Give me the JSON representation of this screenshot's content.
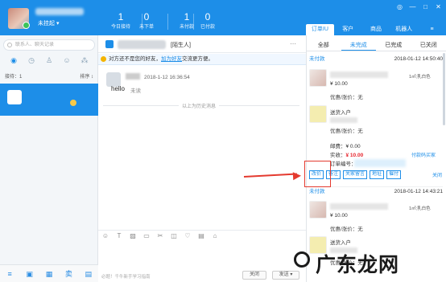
{
  "header": {
    "status": "未挂起 ▾",
    "stats": [
      {
        "num": "1",
        "label": "今日接待"
      },
      {
        "num": "0",
        "label": "未下单"
      },
      {
        "num": "1",
        "label": "未付款"
      },
      {
        "num": "0",
        "label": "已付款"
      }
    ],
    "right_tabs": [
      "订单IU",
      "客户",
      "商品",
      "机器人",
      "≡"
    ],
    "window_controls": [
      "◎",
      "—",
      "□",
      "✕"
    ]
  },
  "left": {
    "search_placeholder": "联系人、聊天记录",
    "sort_left": "接待：1",
    "sort_right": "排序 ↕",
    "nav_icons": [
      "chat-icon",
      "clock-icon",
      "person-icon",
      "group-icon",
      "share-icon"
    ],
    "bottom_icons": [
      "menu-icon",
      "inbox-icon",
      "grid-icon",
      "form-icon",
      "shop-icon"
    ]
  },
  "chat": {
    "tag": "[陌生人]",
    "notice_prefix": "对方还不是您的好友，",
    "notice_link": "加为好友",
    "notice_suffix": "交流更方便。",
    "msg_time": "2018-1-12 16:36:54",
    "msg_text": "hello",
    "msg_unread": "未读",
    "history_label": "以上为历史消息",
    "input_hint": "必题！千牛新手学习指南",
    "close_label": "关闭",
    "send_label": "发送 ▾",
    "toolbar_icons": [
      "emoji-icon",
      "text-icon",
      "image-icon",
      "folder-icon",
      "scissors-icon",
      "record-icon",
      "heart-icon",
      "coupon-icon",
      "more-icon"
    ]
  },
  "orders": {
    "tabs": [
      "全部",
      "未完成",
      "已完成",
      "已关闭"
    ],
    "active_tab": 1,
    "order1": {
      "status": "未付款",
      "time": "2018-01-12 14:50:40",
      "price": "¥ 10.00",
      "spec": "1㎡;乳白色",
      "discount": "优惠/涨价：无",
      "gift_title": "送货入户",
      "gift_discount": "优惠/涨价：无",
      "shipping": "邮费：¥ 0.00",
      "paid_label": "实收：",
      "paid_value": "¥ 10.00",
      "orderno": "订单编号：",
      "payway": "付款码买家",
      "actions": [
        "改价",
        "备注",
        "关家留言",
        "地址",
        "催付"
      ],
      "close": "关闭"
    },
    "order2": {
      "status": "未付款",
      "time": "2018-01-12 14:43:21",
      "price": "¥ 10.00",
      "spec": "1㎡;乳白色",
      "discount": "优惠/涨价：无",
      "gift_title": "送货入户",
      "gift_discount": "优惠/涨价：无"
    }
  },
  "watermark": "广东龙网"
}
